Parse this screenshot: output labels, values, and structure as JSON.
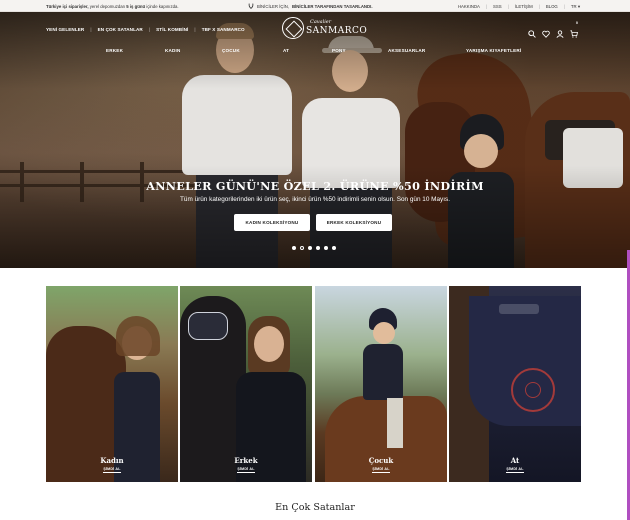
{
  "topbar": {
    "shipping_left_bold": "Türkiye içi siparişler,",
    "shipping_left_rest": "yerel depomuzdan",
    "shipping_days": "5 iş günü",
    "shipping_tail": "içinde kapınızda.",
    "center_prefix": "BİNİCİLER İÇİN,",
    "center_bold": "BİNİCİLER TARAFINDAN TASARLANDI.",
    "links": [
      "HAKKINDA",
      "SSS",
      "İLETİŞİM",
      "BLOG",
      "TR ▾"
    ]
  },
  "header": {
    "nav": [
      "YENİ GELENLER",
      "EN ÇOK SATANLAR",
      "STİL KOMBİNİ",
      "TBF X SANMARCO"
    ],
    "logo_script": "Cavalier",
    "logo_brand": "SANMARCO",
    "categories": [
      "ERKEK",
      "KADIN",
      "ÇOCUK",
      "AT",
      "PONY",
      "AKSESUARLAR",
      "YARIŞMA KIYAFETLERİ"
    ],
    "icons": [
      "search-icon",
      "heart-icon",
      "user-icon",
      "cart-icon"
    ],
    "cart_count": "0"
  },
  "hero": {
    "title": "ANNELER GÜNÜ'NE ÖZEL 2. ÜRÜNE %50 İNDİRİM",
    "subtitle": "Tüm ürün kategorilerinden iki ürün seç, ikinci ürün %50 indirimli senin olsun. Son gün 10 Mayıs.",
    "btn_women": "KADIN KOLEKSİYONU",
    "btn_men": "ERKEK KOLEKSİYONU",
    "slides_total": 6,
    "active_slide": 2
  },
  "tiles": [
    {
      "title": "Kadın",
      "link": "ŞİMDİ AL"
    },
    {
      "title": "Erkek",
      "link": "ŞİMDİ AL"
    },
    {
      "title": "Çocuk",
      "link": "ŞİMDİ AL"
    },
    {
      "title": "At",
      "link": "ŞİMDİ AL"
    }
  ],
  "best_sellers": {
    "title": "En Çok Satanlar"
  },
  "colors": {
    "topbar_bg": "#f5f3f1",
    "hero_dark": "#3d2e22",
    "text_dark": "#222222",
    "white": "#ffffff"
  }
}
